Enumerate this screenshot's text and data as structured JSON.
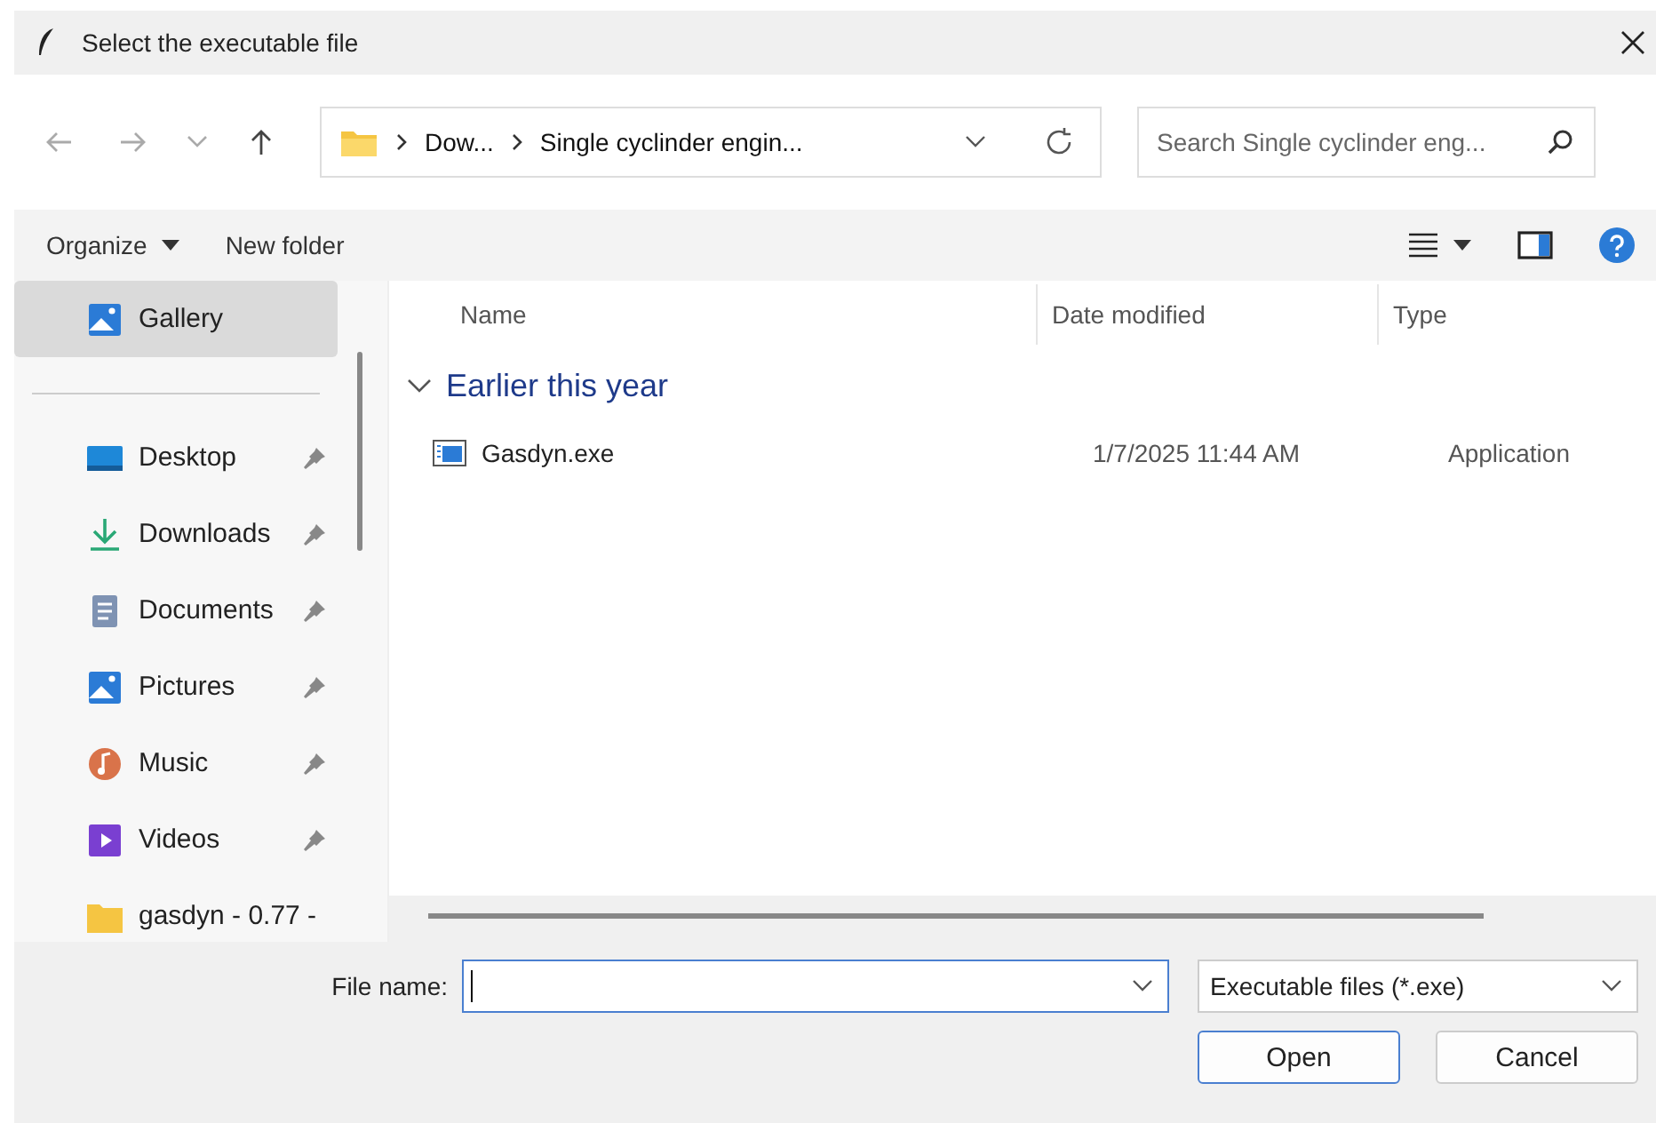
{
  "window": {
    "title": "Select the executable file"
  },
  "address": {
    "crumbs": [
      "Dow...",
      "Single cyclinder engin..."
    ]
  },
  "search": {
    "placeholder": "Search Single cyclinder eng..."
  },
  "toolbar": {
    "organize": "Organize",
    "new_folder": "New folder"
  },
  "sidebar": {
    "items": [
      {
        "label": "Gallery",
        "kind": "gallery",
        "selected": true,
        "pinned": false
      },
      {
        "label": "Desktop",
        "kind": "desktop",
        "selected": false,
        "pinned": true
      },
      {
        "label": "Downloads",
        "kind": "downloads",
        "selected": false,
        "pinned": true
      },
      {
        "label": "Documents",
        "kind": "documents",
        "selected": false,
        "pinned": true
      },
      {
        "label": "Pictures",
        "kind": "pictures",
        "selected": false,
        "pinned": true
      },
      {
        "label": "Music",
        "kind": "music",
        "selected": false,
        "pinned": true
      },
      {
        "label": "Videos",
        "kind": "videos",
        "selected": false,
        "pinned": true
      },
      {
        "label": "gasdyn - 0.77 -",
        "kind": "folder",
        "selected": false,
        "pinned": false
      }
    ]
  },
  "table": {
    "columns": [
      "Name",
      "Date modified",
      "Type"
    ],
    "groups": [
      {
        "title": "Earlier this year",
        "expanded": true,
        "rows": [
          {
            "name": "Gasdyn.exe",
            "date": "1/7/2025 11:44 AM",
            "type": "Application"
          }
        ]
      }
    ]
  },
  "footer": {
    "file_name_label": "File name:",
    "file_type": "Executable files (*.exe)",
    "buttons": [
      "Open",
      "Cancel"
    ]
  }
}
